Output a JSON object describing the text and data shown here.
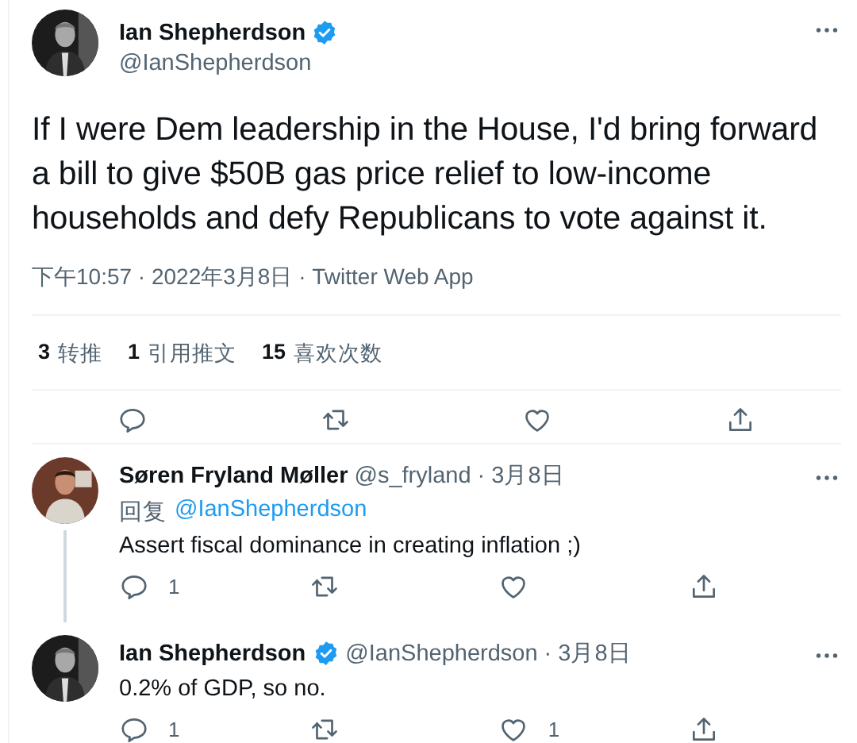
{
  "main_tweet": {
    "author": {
      "name": "Ian Shepherdson",
      "handle": "@IanShepherdson",
      "verified": true
    },
    "text": "If I were Dem leadership in the House, I'd bring forward a bill to give $50B gas price relief to low-income households and defy Republicans to vote against it.",
    "meta": "下午10:57 · 2022年3月8日 · Twitter Web App",
    "stats": [
      {
        "count": "3",
        "label": "转推"
      },
      {
        "count": "1",
        "label": "引用推文"
      },
      {
        "count": "15",
        "label": "喜欢次数"
      }
    ],
    "actions": [
      {
        "kind": "reply"
      },
      {
        "kind": "retweet"
      },
      {
        "kind": "like"
      },
      {
        "kind": "share"
      }
    ]
  },
  "replies": [
    {
      "author": {
        "name": "Søren Fryland Møller",
        "handle": "@s_fryland",
        "verified": false
      },
      "date": "· 3月8日",
      "thread_line": true,
      "reply_to": {
        "prefix": "回复",
        "handle": "@IanShepherdson"
      },
      "text": "Assert fiscal dominance in creating inflation ;)",
      "actions": [
        {
          "kind": "reply",
          "count": "1"
        },
        {
          "kind": "retweet"
        },
        {
          "kind": "like"
        },
        {
          "kind": "share"
        }
      ]
    },
    {
      "author": {
        "name": "Ian Shepherdson",
        "handle": "@IanShepherdson",
        "verified": true
      },
      "date": "· 3月8日",
      "thread_line": false,
      "text": "0.2% of GDP, so no.",
      "actions": [
        {
          "kind": "reply",
          "count": "1"
        },
        {
          "kind": "retweet"
        },
        {
          "kind": "like",
          "count": "1"
        },
        {
          "kind": "share"
        }
      ]
    }
  ]
}
